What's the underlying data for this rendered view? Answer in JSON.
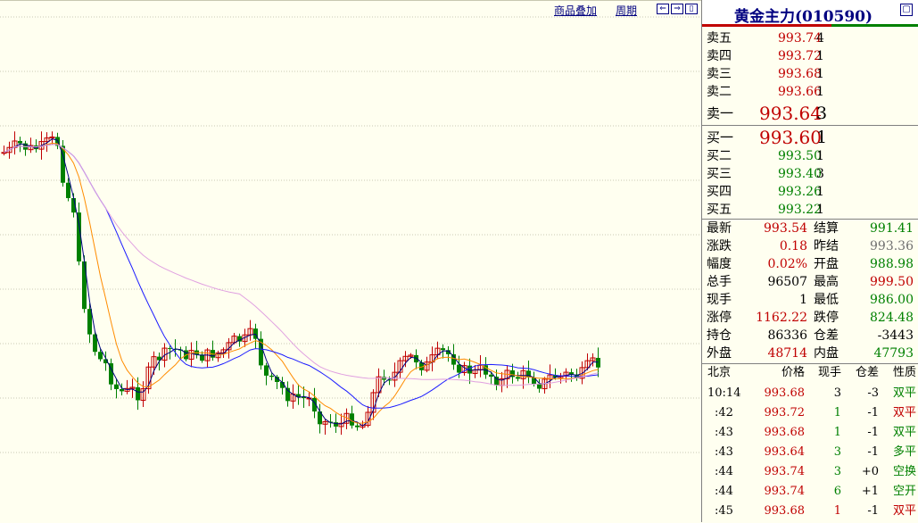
{
  "toolbar": {
    "overlay_label": "商品叠加",
    "period_label": "周期",
    "btn_prev": "⇐",
    "btn_next": "⇒",
    "btn_layout": "▯"
  },
  "panel": {
    "title": "黄金主力(010590)",
    "title_button": "▢",
    "asks": [
      {
        "label": "卖五",
        "price": "993.74",
        "qty": "4"
      },
      {
        "label": "卖四",
        "price": "993.72",
        "qty": "1"
      },
      {
        "label": "卖三",
        "price": "993.68",
        "qty": "1"
      },
      {
        "label": "卖二",
        "price": "993.66",
        "qty": "1"
      },
      {
        "label": "卖一",
        "price": "993.64",
        "qty": "3"
      }
    ],
    "bids": [
      {
        "label": "买一",
        "price": "993.60",
        "qty": "1"
      },
      {
        "label": "买二",
        "price": "993.50",
        "qty": "1"
      },
      {
        "label": "买三",
        "price": "993.40",
        "qty": "3"
      },
      {
        "label": "买四",
        "price": "993.26",
        "qty": "1"
      },
      {
        "label": "买五",
        "price": "993.22",
        "qty": "1"
      }
    ],
    "stats": [
      {
        "l1": "最新",
        "v1": "993.54",
        "c1": "red",
        "l2": "结算",
        "v2": "991.41",
        "c2": "grn"
      },
      {
        "l1": "涨跌",
        "v1": "0.18",
        "c1": "red",
        "l2": "昨结",
        "v2": "993.36",
        "c2": "gry"
      },
      {
        "l1": "幅度",
        "v1": "0.02%",
        "c1": "red",
        "l2": "开盘",
        "v2": "988.98",
        "c2": "grn"
      },
      {
        "l1": "总手",
        "v1": "96507",
        "c1": "blk",
        "l2": "最高",
        "v2": "999.50",
        "c2": "red"
      },
      {
        "l1": "现手",
        "v1": "1",
        "c1": "blk",
        "l2": "最低",
        "v2": "986.00",
        "c2": "grn"
      },
      {
        "l1": "涨停",
        "v1": "1162.22",
        "c1": "red",
        "l2": "跌停",
        "v2": "824.48",
        "c2": "grn"
      },
      {
        "l1": "持仓",
        "v1": "86336",
        "c1": "blk",
        "l2": "仓差",
        "v2": "-3443",
        "c2": "blk"
      },
      {
        "l1": "外盘",
        "v1": "48714",
        "c1": "red",
        "l2": "内盘",
        "v2": "47793",
        "c2": "grn"
      }
    ],
    "trades_header": {
      "time": "北京",
      "price": "价格",
      "vol": "现手",
      "chg": "仓差",
      "nature": "性质"
    },
    "trades": [
      {
        "time": "10:14",
        "price": "993.68",
        "vol": "3",
        "vcolor": "blk",
        "chg": "-3",
        "nature": "双平",
        "ncolor": "grn"
      },
      {
        "time": ":42",
        "price": "993.72",
        "vol": "1",
        "vcolor": "grn",
        "chg": "-1",
        "nature": "双平",
        "ncolor": "red"
      },
      {
        "time": ":43",
        "price": "993.68",
        "vol": "1",
        "vcolor": "grn",
        "chg": "-1",
        "nature": "双平",
        "ncolor": "grn"
      },
      {
        "time": ":43",
        "price": "993.64",
        "vol": "3",
        "vcolor": "grn",
        "chg": "-1",
        "nature": "多平",
        "ncolor": "grn"
      },
      {
        "time": ":44",
        "price": "993.74",
        "vol": "3",
        "vcolor": "grn",
        "chg": "+0",
        "nature": "空换",
        "ncolor": "grn"
      },
      {
        "time": ":44",
        "price": "993.74",
        "vol": "6",
        "vcolor": "grn",
        "chg": "+1",
        "nature": "空开",
        "ncolor": "grn"
      },
      {
        "time": ":45",
        "price": "993.68",
        "vol": "1",
        "vcolor": "red",
        "chg": "-1",
        "nature": "双平",
        "ncolor": "red"
      }
    ]
  },
  "colors": {
    "up": "#c00000",
    "down": "#008000",
    "background": "#fffff0",
    "ma_series": [
      "#000080",
      "#ff8c00",
      "#1c1cff",
      "#e0a0e0"
    ]
  }
}
